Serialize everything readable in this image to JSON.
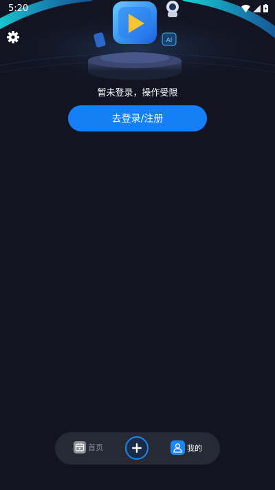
{
  "status_bar": {
    "time": "5:20"
  },
  "header": {
    "settings_icon": "gear-icon"
  },
  "profile": {
    "login_hint": "暂未登录，操作受限",
    "login_button_label": "去登录/注册",
    "hero_badge": "AI"
  },
  "bottom_nav": {
    "home_label": "首页",
    "mine_label": "我的",
    "add_icon": "plus-icon"
  },
  "colors": {
    "background": "#121421",
    "accent": "#1580f5",
    "nav_background": "#262a35"
  }
}
